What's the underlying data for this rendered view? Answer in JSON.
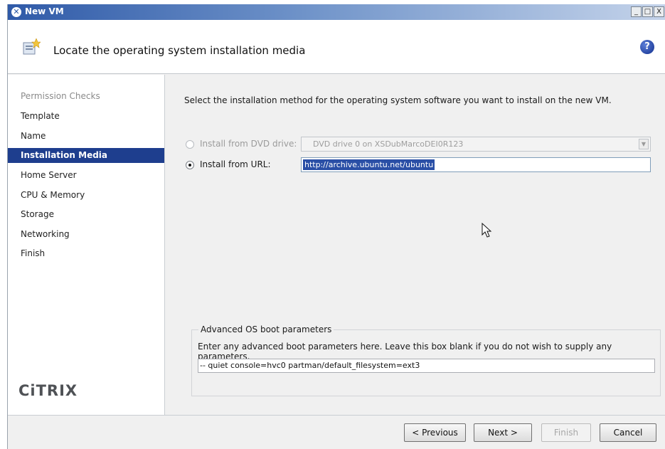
{
  "window": {
    "title": "New VM",
    "title_icon": "x-logo-icon",
    "controls": {
      "minimize": "_",
      "maximize": "□",
      "close": "X"
    }
  },
  "header": {
    "title": "Locate the operating system installation media",
    "help_label": "?"
  },
  "sidebar": {
    "steps": [
      {
        "label": "Permission Checks",
        "state": "disabled"
      },
      {
        "label": "Template",
        "state": "normal"
      },
      {
        "label": "Name",
        "state": "normal"
      },
      {
        "label": "Installation Media",
        "state": "active"
      },
      {
        "label": "Home Server",
        "state": "normal"
      },
      {
        "label": "CPU & Memory",
        "state": "normal"
      },
      {
        "label": "Storage",
        "state": "normal"
      },
      {
        "label": "Networking",
        "state": "normal"
      },
      {
        "label": "Finish",
        "state": "normal"
      }
    ],
    "brand": "CiTRIX"
  },
  "main": {
    "instruction": "Select the installation method for the operating system software you want to install on the new VM.",
    "options": {
      "dvd": {
        "label": "Install from DVD drive:",
        "selected": false,
        "enabled": false,
        "value": "DVD drive 0 on XSDubMarcoDEI0R123"
      },
      "url": {
        "label": "Install from URL:",
        "selected": true,
        "enabled": true,
        "value": "http://archive.ubuntu.net/ubuntu"
      }
    },
    "advanced": {
      "title": "Advanced OS boot parameters",
      "description": "Enter any advanced boot parameters here. Leave this box blank if you do not wish to supply any parameters.",
      "value": "-- quiet console=hvc0 partman/default_filesystem=ext3"
    }
  },
  "footer": {
    "previous": "< Previous",
    "next": "Next >",
    "finish": "Finish",
    "cancel": "Cancel"
  },
  "colors": {
    "active_step_bg": "#1e3e8e",
    "selection_bg": "#2a4fa6",
    "titlebar_start": "#2f5aa8"
  }
}
